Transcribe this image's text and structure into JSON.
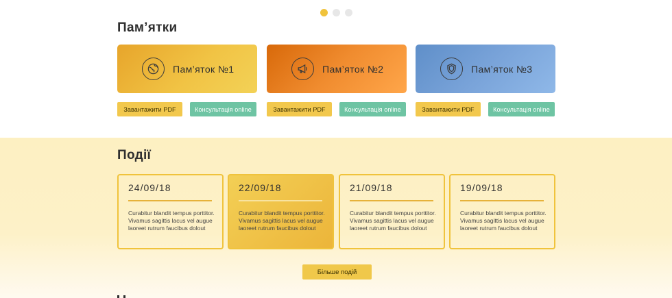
{
  "carousel": {
    "dots": 3,
    "active_index": 0
  },
  "memos": {
    "title": "Пам’ятки",
    "cards": [
      {
        "title": "Пам’яток №1",
        "icon": "globe-icon",
        "pdf_label": "Завантажити PDF",
        "consult_label": "Консультація online"
      },
      {
        "title": "Пам’яток №2",
        "icon": "megaphone-icon",
        "pdf_label": "Завантажити PDF",
        "consult_label": "Консультація online"
      },
      {
        "title": "Пам’яток №3",
        "icon": "shield-icon",
        "pdf_label": "Завантажити PDF",
        "consult_label": "Консультація online"
      }
    ]
  },
  "events": {
    "title": "Події",
    "items": [
      {
        "date": "24/09/18",
        "text": "Curabitur blandit tempus porttitor. Vivamus sagittis lacus vel augue laoreet rutrum faucibus dolout"
      },
      {
        "date": "22/09/18",
        "text": "Curabitur blandit tempus porttitor. Vivamus sagittis lacus vel augue laoreet rutrum faucibus dolout"
      },
      {
        "date": "21/09/18",
        "text": "Curabitur blandit tempus porttitor. Vivamus sagittis lacus vel augue laoreet rutrum faucibus dolout"
      },
      {
        "date": "19/09/18",
        "text": "Curabitur blandit tempus porttitor. Vivamus sagittis lacus vel augue laoreet rutrum faucibus dolout"
      }
    ],
    "more_label": "Більше подій"
  },
  "colors": {
    "accent": "#f0c33c",
    "consult": "#6ec4a3"
  }
}
